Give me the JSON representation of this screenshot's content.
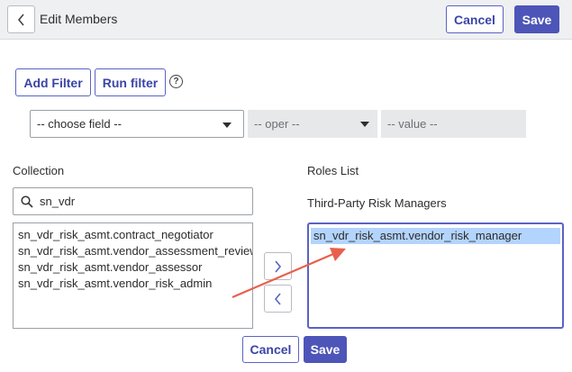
{
  "header": {
    "title": "Edit Members",
    "cancel_label": "Cancel",
    "save_label": "Save"
  },
  "filter": {
    "add_filter_label": "Add Filter",
    "run_filter_label": "Run filter",
    "help_glyph": "?",
    "field_select": "-- choose field --",
    "operator_select": "-- oper --",
    "value_field": "-- value --"
  },
  "collection": {
    "label": "Collection",
    "search_value": "sn_vdr",
    "items": [
      "sn_vdr_risk_asmt.contract_negotiator",
      "sn_vdr_risk_asmt.vendor_assessment_reviewer",
      "sn_vdr_risk_asmt.vendor_assessor",
      "sn_vdr_risk_asmt.vendor_risk_admin"
    ]
  },
  "roles": {
    "label": "Roles List",
    "group_label": "Third-Party Risk Managers",
    "items": [
      "sn_vdr_risk_asmt.vendor_risk_manager"
    ]
  },
  "footer": {
    "cancel_label": "Cancel",
    "save_label": "Save"
  },
  "colors": {
    "primary": "#4d55b8",
    "header_bg": "#eef0f2",
    "selection": "#b3d4fc",
    "annotation_arrow": "#e8604c"
  },
  "icons": [
    "chevron-left-icon",
    "help-icon",
    "caret-down-icon",
    "search-icon",
    "chevron-right-icon"
  ]
}
